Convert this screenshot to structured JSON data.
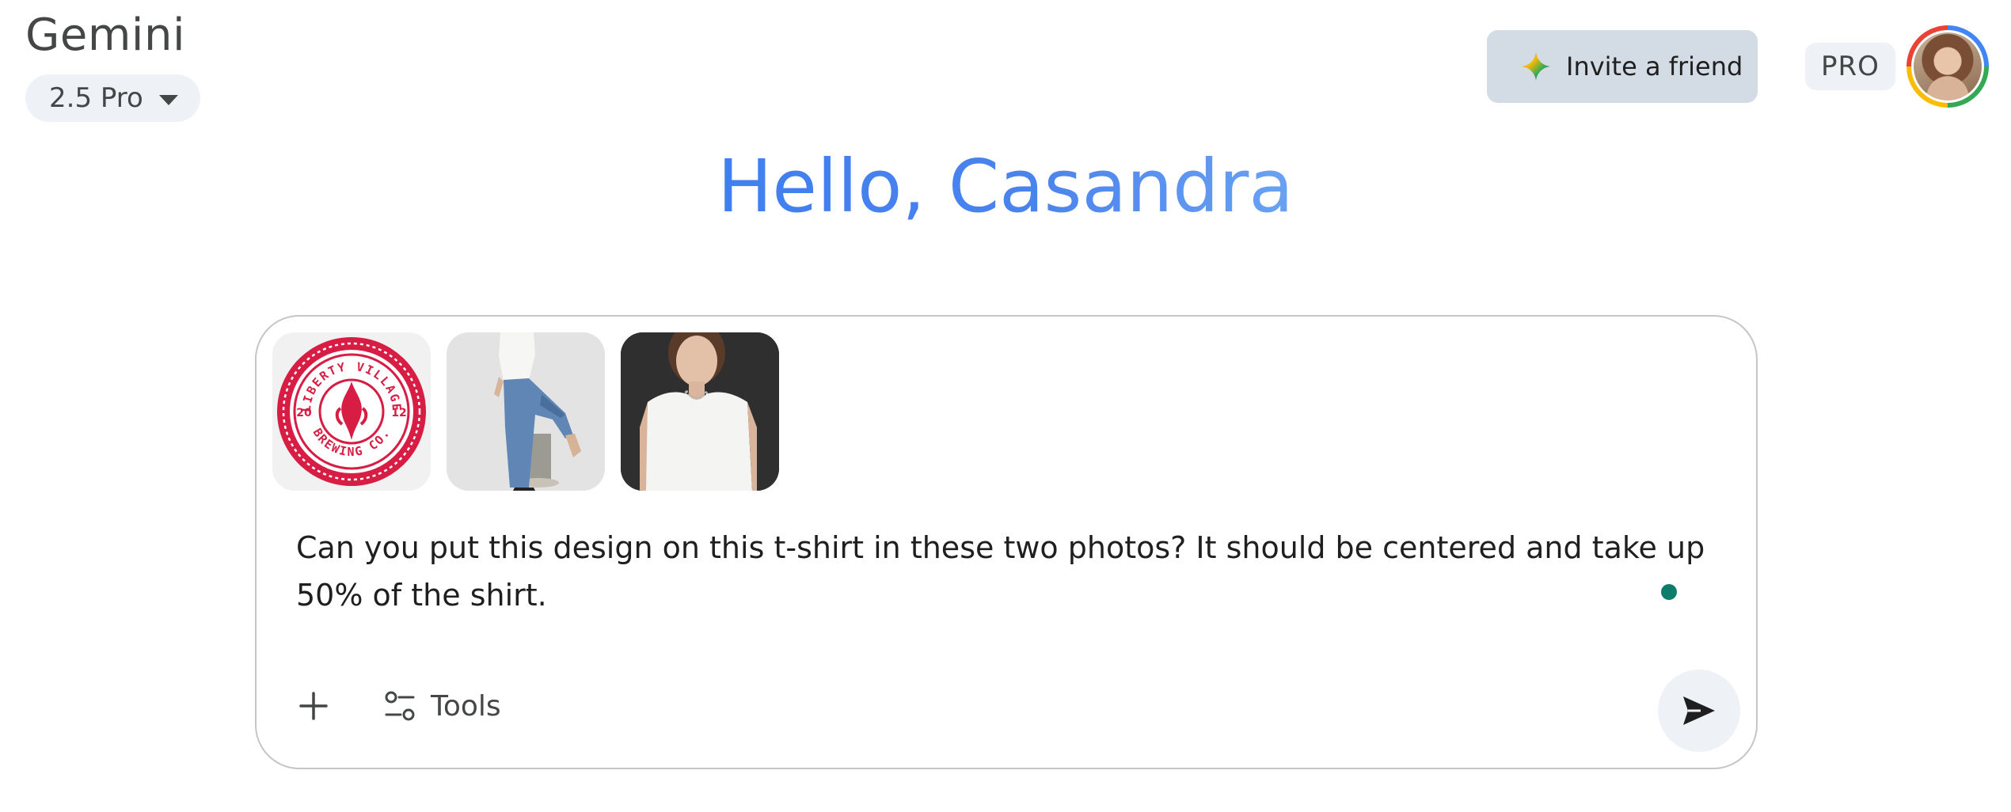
{
  "header": {
    "app_title": "Gemini",
    "model_selector": {
      "label": "2.5 Pro",
      "icon": "caret-down-icon"
    },
    "invite_button": {
      "label": "Invite a friend",
      "icon": "sparkle-icon"
    },
    "plan_badge": "PRO",
    "avatar": {
      "icon": "user-avatar"
    }
  },
  "greeting": "Hello, Casandra",
  "composer": {
    "attachments": [
      {
        "kind": "logo",
        "name": "liberty-village-brewing-logo",
        "logo_text_top": "LIBERTY VILLAGE",
        "logo_text_bottom": "BREWING CO.",
        "logo_year_left": "20",
        "logo_year_right": "12"
      },
      {
        "kind": "photo",
        "name": "model-jeans-photo"
      },
      {
        "kind": "photo",
        "name": "model-portrait-photo"
      }
    ],
    "prompt_text": "Can you put this design on this t-shirt in these two photos? It should be centered and take up 50% of the shirt.",
    "add_button": {
      "icon": "plus-icon"
    },
    "tools_button": {
      "label": "Tools",
      "icon": "tools-icon"
    },
    "send_button": {
      "icon": "send-icon"
    }
  },
  "colors": {
    "greeting_gradient_start": "#3f7ff0",
    "greeting_gradient_end": "#6aa2f2",
    "logo_red": "#d71d44",
    "invite_bg": "#d3dbe5",
    "chip_bg": "#eef1f6",
    "status_dot": "#0b7d6a"
  }
}
